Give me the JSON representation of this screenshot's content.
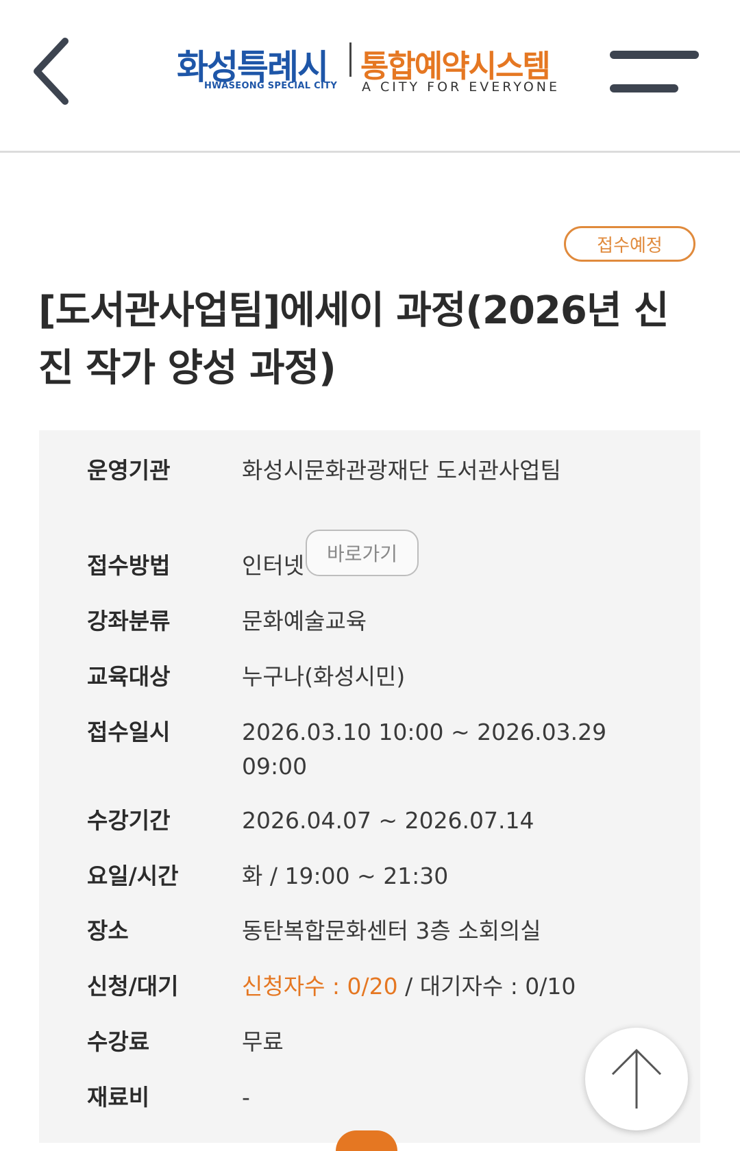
{
  "header": {
    "logo_city": "화성특례시",
    "logo_city_en": "HWASEONG SPECIAL CITY",
    "logo_system": "통합예약시스템",
    "logo_system_en": "A CITY FOR EVERYONE",
    "back_icon": "chevron-left-icon",
    "menu_icon": "hamburger-menu-icon"
  },
  "course": {
    "status": "접수예정",
    "title": "[도서관사업팀]에세이 과정(2026년 신진 작가 양성 과정)"
  },
  "details": {
    "org_label": "운영기관",
    "org_value": "화성시문화관광재단 도서관사업팀",
    "goto_label": "바로가기",
    "method_label": "접수방법",
    "method_value": "인터넷",
    "category_label": "강좌분류",
    "category_value": "문화예술교육",
    "target_label": "교육대상",
    "target_value": "누구나(화성시민)",
    "reg_period_label": "접수일시",
    "reg_period_value": "2026.03.10 10:00 ~ 2026.03.29 09:00",
    "course_period_label": "수강기간",
    "course_period_value": "2026.04.07 ~ 2026.07.14",
    "schedule_label": "요일/시간",
    "schedule_value": "화 / 19:00 ~ 21:30",
    "place_label": "장소",
    "place_value": "동탄복합문화센터 3층 소회의실",
    "apply_label": "신청/대기",
    "apply_count": "신청자수 : 0/20",
    "apply_sep": " / ",
    "wait_count": "대기자수 : 0/10",
    "fee_label": "수강료",
    "fee_value": "무료",
    "material_label": "재료비",
    "material_value": "-"
  },
  "colors": {
    "brand_blue": "#1e56a8",
    "accent_orange": "#e57722",
    "badge_orange": "#e08a3c"
  },
  "scroll_top_icon": "arrow-up-icon"
}
